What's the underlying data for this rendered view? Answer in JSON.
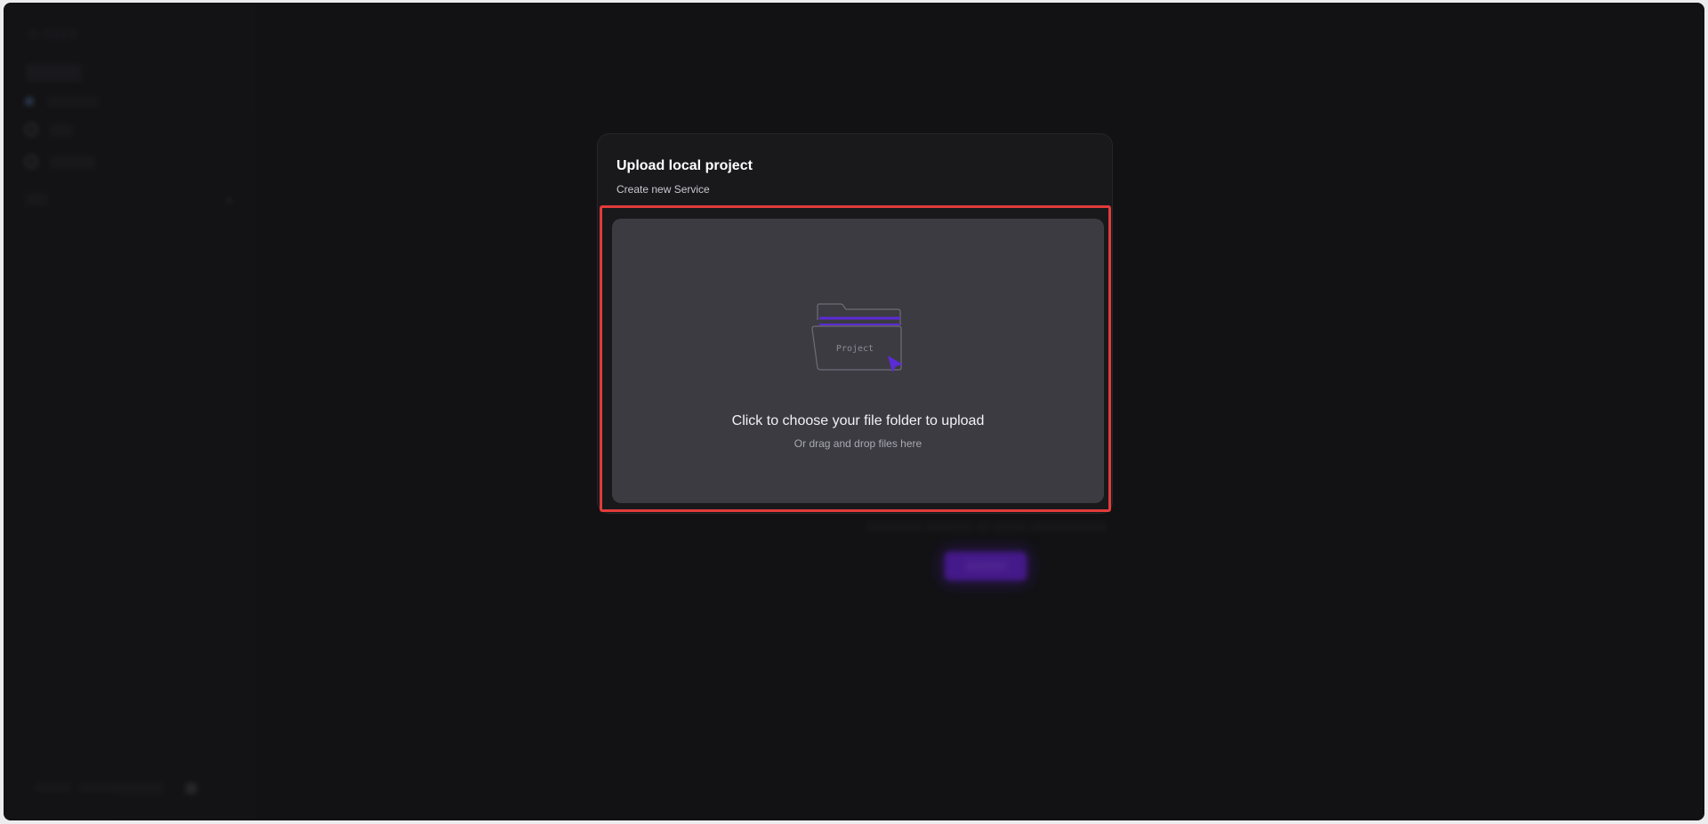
{
  "modal": {
    "title": "Upload local project",
    "subtitle": "Create new Service"
  },
  "dropzone": {
    "folder_label": "Project",
    "primary_text": "Click to choose your file folder to upload",
    "secondary_text": "Or drag and drop files here"
  },
  "colors": {
    "accent": "#5b2bd6",
    "highlight": "#e23b3b",
    "modal_bg": "#19191c",
    "dropzone_bg": "#3c3b42"
  },
  "icons": {
    "folder": "folder-upload-icon",
    "arrow": "cursor-arrow-icon"
  }
}
